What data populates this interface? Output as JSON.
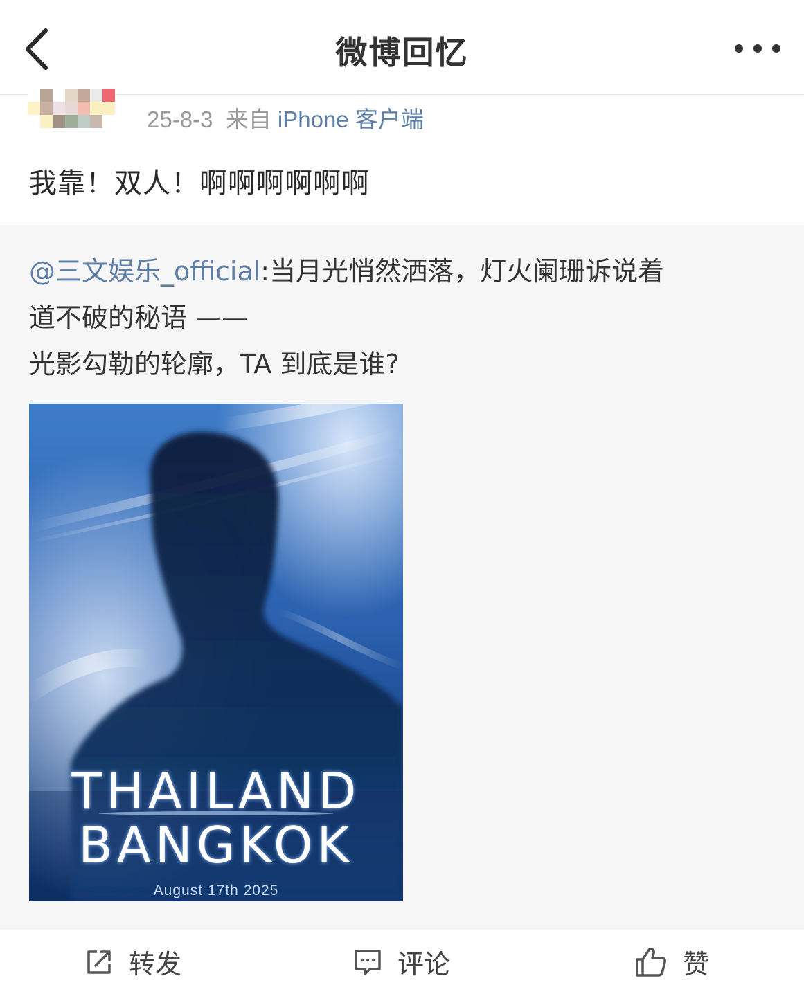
{
  "nav": {
    "title": "微博回忆",
    "back_icon": "chevron-left-icon",
    "more_icon": "ellipsis-icon"
  },
  "post": {
    "date": "25-8-3",
    "source_prefix": "来自",
    "source": "iPhone 客户端",
    "text": "我靠！双人！啊啊啊啊啊啊"
  },
  "repost": {
    "mention": "@三文娱乐_official",
    "line1_rest": ":当月光悄然洒落，灯火阑珊诉说着",
    "line2": "道不破的秘语 ——",
    "line3": "光影勾勒的轮廓，TA 到底是谁?"
  },
  "poster": {
    "line1": "THAILAND",
    "line2": "BANGKOK",
    "date": "August 17th 2025"
  },
  "actions": {
    "repost_label": "转发",
    "comment_label": "评论",
    "like_label": "赞"
  },
  "colors": {
    "link": "#5d7ea6",
    "repost_bg": "#f6f6f6",
    "poster_blue": "#1a4a8c"
  }
}
